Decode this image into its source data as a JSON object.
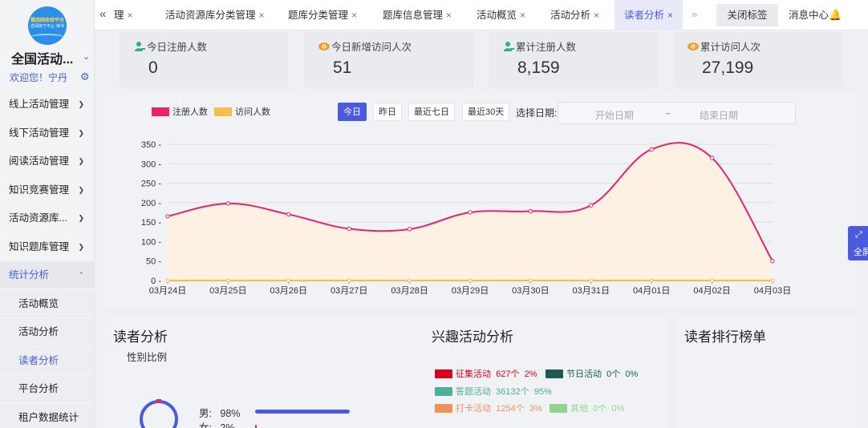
{
  "sidebar": {
    "logo_line1": "慧阅网体验平台",
    "logo_line2": "志阅如下不止·读书",
    "org_name": "全国活动...",
    "welcome": "欢迎您！宁丹",
    "menu": [
      {
        "label": "线上活动管理"
      },
      {
        "label": "线下活动管理"
      },
      {
        "label": "阅读活动管理"
      },
      {
        "label": "知识竞赛管理"
      },
      {
        "label": "活动资源库..."
      },
      {
        "label": "知识题库管理"
      },
      {
        "label": "统计分析"
      }
    ],
    "submenu": [
      {
        "label": "活动概览"
      },
      {
        "label": "活动分析"
      },
      {
        "label": "读者分析"
      },
      {
        "label": "平台分析"
      },
      {
        "label": "租户数据统计"
      }
    ]
  },
  "tabs": {
    "items": [
      {
        "label": "理"
      },
      {
        "label": "活动资源库分类管理"
      },
      {
        "label": "题库分类管理"
      },
      {
        "label": "题库信息管理"
      },
      {
        "label": "活动概览"
      },
      {
        "label": "活动分析"
      },
      {
        "label": "读者分析"
      }
    ],
    "close_x": "×",
    "close_tabs": "关闭标签",
    "message_center": "消息中心"
  },
  "stats": [
    {
      "label": "今日注册人数",
      "value": "0",
      "icon": "user-icon"
    },
    {
      "label": "今日新增访问人次",
      "value": "51",
      "icon": "eye-icon"
    },
    {
      "label": "累计注册人数",
      "value": "8,159",
      "icon": "user-icon"
    },
    {
      "label": "累计访问人次",
      "value": "27,199",
      "icon": "eye-icon"
    }
  ],
  "chart_controls": {
    "legend_register": "注册人数",
    "legend_visit": "访问人数",
    "btn_today": "今日",
    "btn_yesterday": "昨日",
    "btn_7days": "最近七日",
    "btn_30days": "最近30天",
    "date_label": "选择日期:",
    "start_placeholder": "开始日期",
    "separator": "~",
    "end_placeholder": "结束日期"
  },
  "colors": {
    "accent": "#4a5be0",
    "register_line": "#e8226e",
    "register_fill": "#fdf1e3",
    "visit_line": "#f7bc49"
  },
  "chart_data": {
    "type": "line",
    "categories": [
      "03月24日",
      "03月25日",
      "03月26日",
      "03月27日",
      "03月28日",
      "03月29日",
      "03月30日",
      "03月31日",
      "04月01日",
      "04月02日",
      "04月03日"
    ],
    "series": [
      {
        "name": "注册人数",
        "values": [
          165,
          198,
          170,
          133,
          132,
          175,
          178,
          193,
          337,
          315,
          50
        ]
      },
      {
        "name": "访问人数",
        "values": [
          0,
          0,
          0,
          0,
          0,
          0,
          0,
          0,
          0,
          0,
          0
        ]
      }
    ],
    "ylim": [
      0,
      350
    ],
    "yticks": [
      0,
      50,
      100,
      150,
      200,
      250,
      300,
      350
    ],
    "legend_position": "top-left",
    "grid": true
  },
  "reader": {
    "title": "读者分析",
    "gender_title": "性别比例",
    "male_label": "男:",
    "male_pct": "98%",
    "male_fraction": 0.98,
    "female_label": "女:",
    "female_pct": "2%",
    "female_fraction": 0.02
  },
  "interest": {
    "title": "兴趣活动分析",
    "items": [
      {
        "label": "征集活动",
        "count": "627个",
        "pct": "2%",
        "color": "#d9001b"
      },
      {
        "label": "节日活动",
        "count": "0个",
        "pct": "0%",
        "color": "#1e5a52"
      },
      {
        "label": "答题活动",
        "count": "36132个",
        "pct": "95%",
        "color": "#4fae9b"
      },
      {
        "label": "打卡活动",
        "count": "1254个",
        "pct": "3%",
        "color": "#f0915a"
      },
      {
        "label": "其他",
        "count": "0个",
        "pct": "0%",
        "color": "#8fd48f"
      }
    ]
  },
  "ranking": {
    "title": "读者排行榜单"
  },
  "fullscreen": {
    "label": "全屏"
  }
}
